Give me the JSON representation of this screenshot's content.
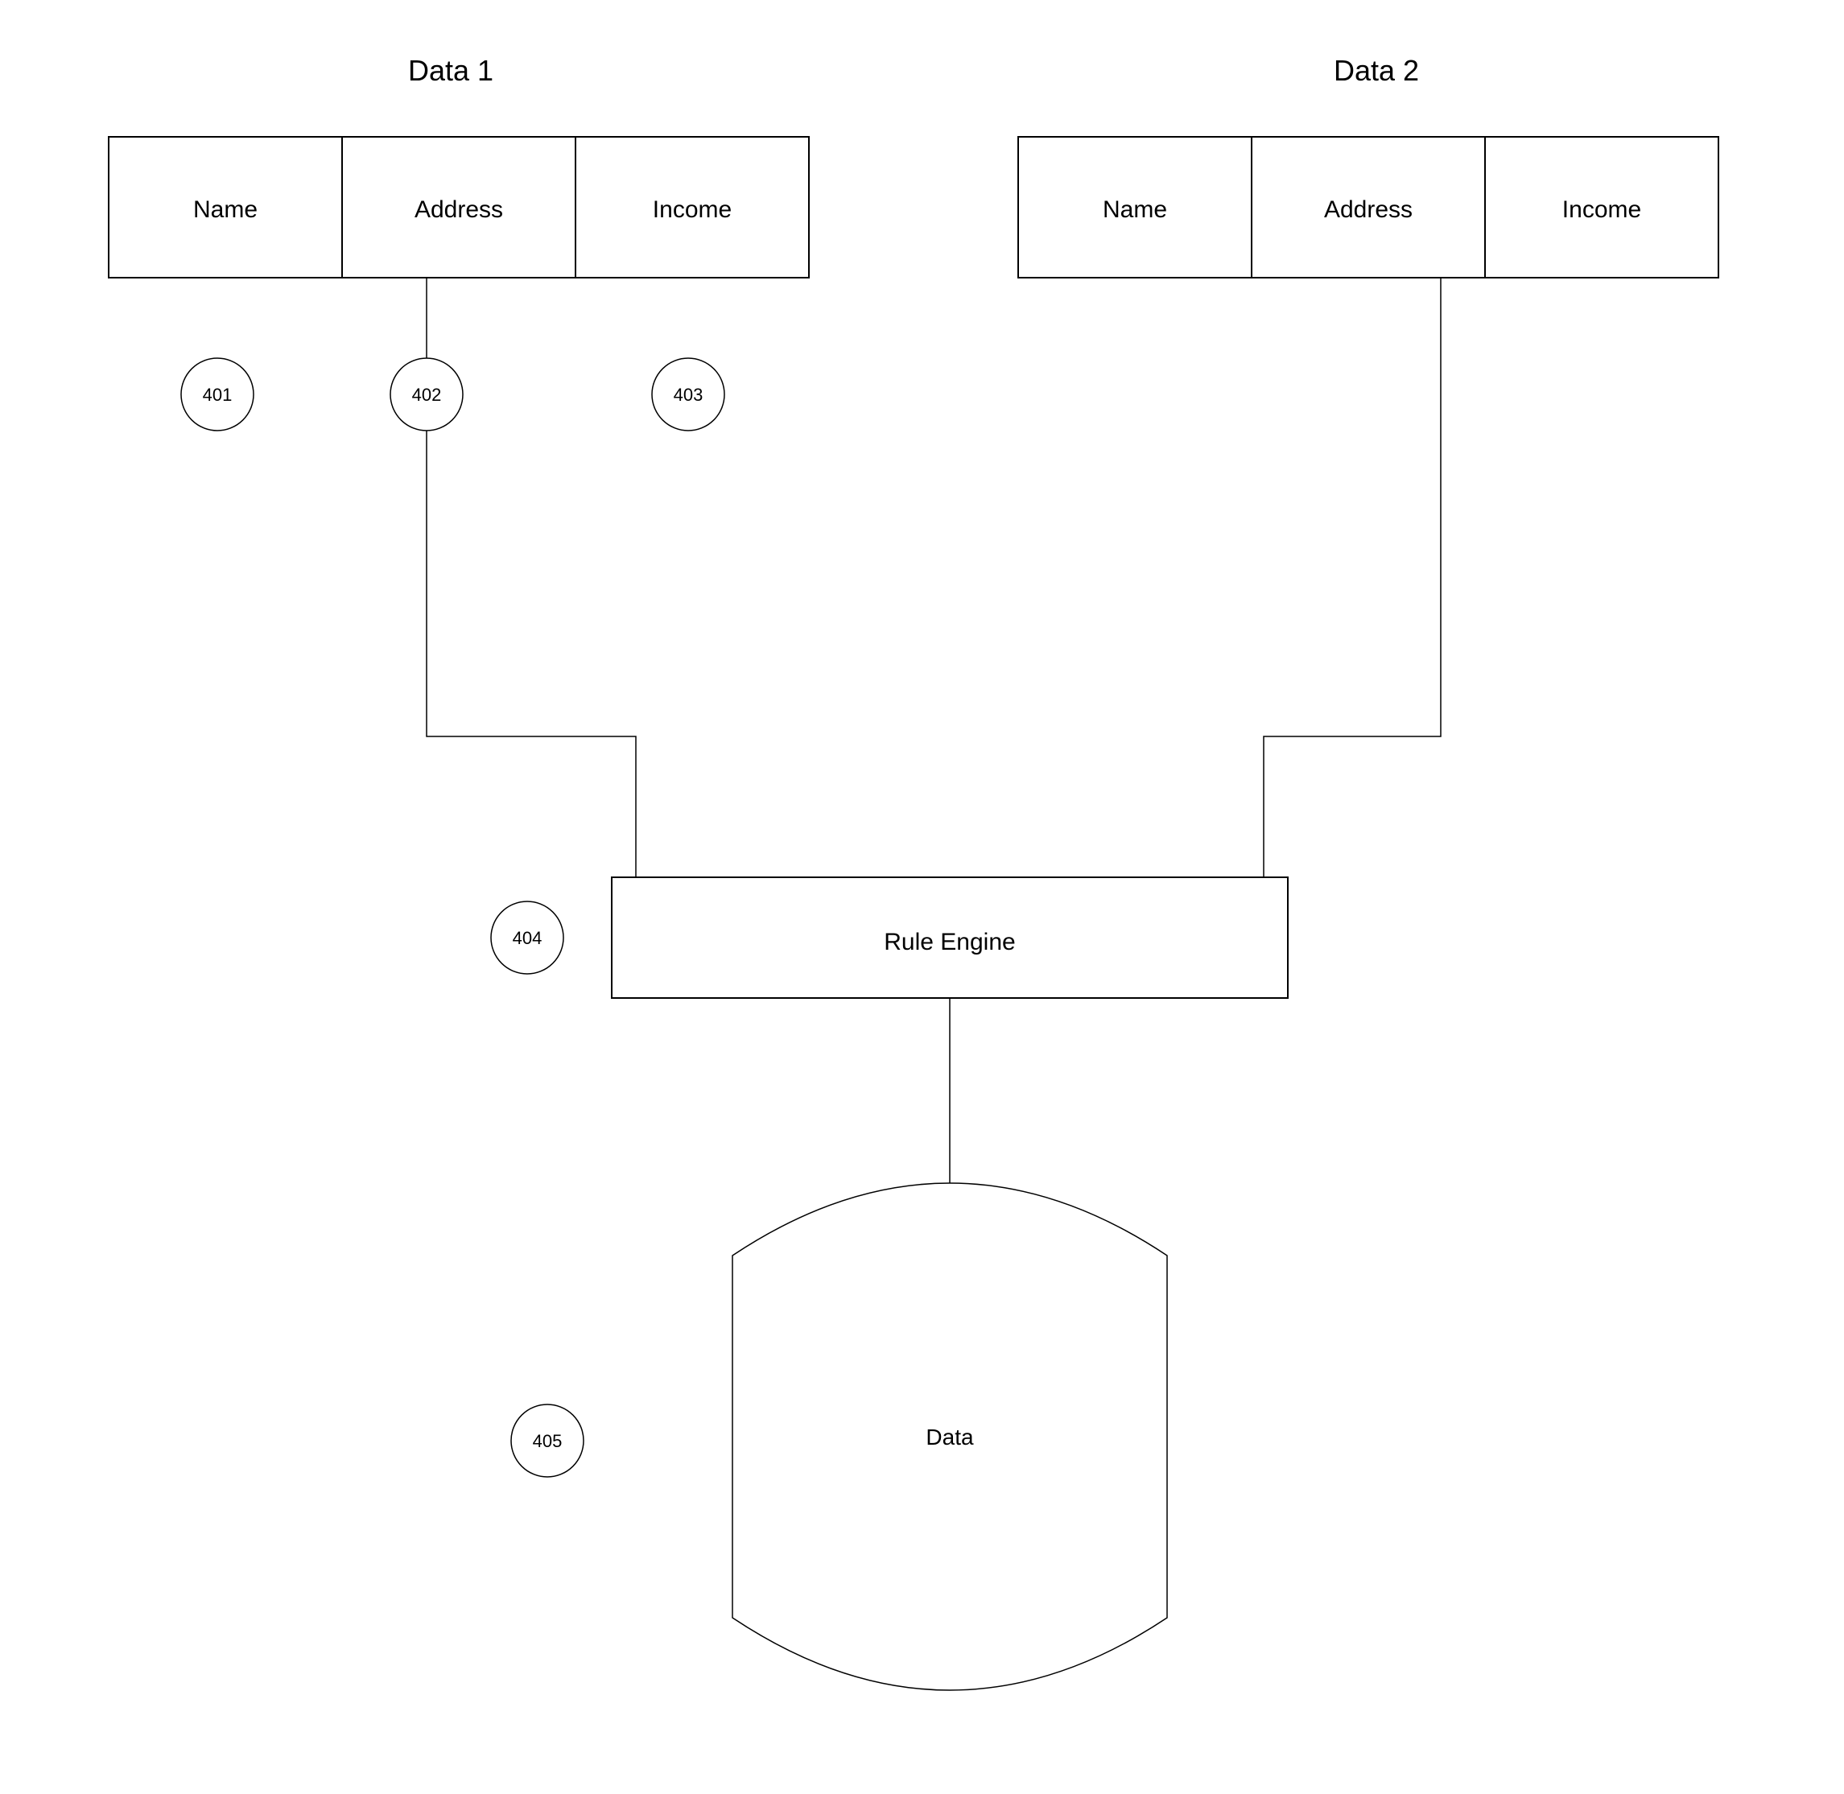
{
  "titles": {
    "data1": "Data 1",
    "data2": "Data 2"
  },
  "data1_cells": [
    "Name",
    "Address",
    "Income"
  ],
  "data2_cells": [
    "Name",
    "Address",
    "Income"
  ],
  "circles": {
    "c401": "401",
    "c402": "402",
    "c403": "403",
    "c404": "404",
    "c405": "405"
  },
  "rule_engine_label": "Rule Engine",
  "data_store_label": "Data"
}
